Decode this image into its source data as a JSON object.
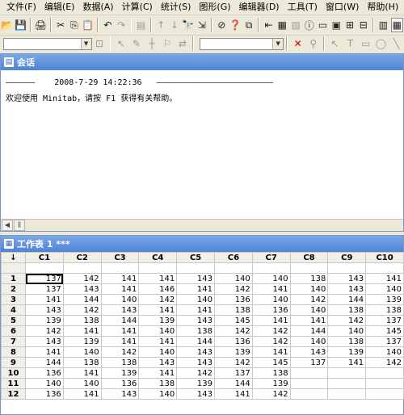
{
  "menu": [
    "文件(F)",
    "编辑(E)",
    "数据(A)",
    "计算(C)",
    "统计(S)",
    "图形(G)",
    "编辑器(D)",
    "工具(T)",
    "窗口(W)",
    "帮助(H)"
  ],
  "session": {
    "title": "会话",
    "header_line": "——————    2008-7-29 14:22:36   ————————————————————————",
    "welcome": "欢迎使用 Minitab，请按 F1 获得有关帮助。"
  },
  "worksheet": {
    "title": "工作表 1 ***",
    "corner": "↓",
    "columns": [
      "C1",
      "C2",
      "C3",
      "C4",
      "C5",
      "C6",
      "C7",
      "C8",
      "C9",
      "C10"
    ],
    "rows": [
      {
        "n": "1",
        "v": [
          "137",
          "142",
          "141",
          "141",
          "143",
          "140",
          "140",
          "138",
          "143",
          "141"
        ]
      },
      {
        "n": "2",
        "v": [
          "137",
          "143",
          "141",
          "146",
          "141",
          "142",
          "141",
          "140",
          "143",
          "140"
        ]
      },
      {
        "n": "3",
        "v": [
          "141",
          "144",
          "140",
          "142",
          "140",
          "136",
          "140",
          "142",
          "144",
          "139"
        ]
      },
      {
        "n": "4",
        "v": [
          "143",
          "142",
          "143",
          "141",
          "141",
          "138",
          "136",
          "140",
          "138",
          "138"
        ]
      },
      {
        "n": "5",
        "v": [
          "139",
          "138",
          "144",
          "139",
          "143",
          "145",
          "141",
          "141",
          "142",
          "137"
        ]
      },
      {
        "n": "6",
        "v": [
          "142",
          "141",
          "141",
          "140",
          "138",
          "142",
          "142",
          "144",
          "140",
          "145"
        ]
      },
      {
        "n": "7",
        "v": [
          "143",
          "139",
          "141",
          "141",
          "144",
          "136",
          "142",
          "140",
          "138",
          "137"
        ]
      },
      {
        "n": "8",
        "v": [
          "141",
          "140",
          "142",
          "140",
          "143",
          "139",
          "141",
          "143",
          "139",
          "140"
        ]
      },
      {
        "n": "9",
        "v": [
          "144",
          "138",
          "138",
          "143",
          "143",
          "142",
          "145",
          "137",
          "141",
          "142"
        ]
      },
      {
        "n": "10",
        "v": [
          "136",
          "141",
          "139",
          "141",
          "142",
          "137",
          "138",
          "",
          "",
          ""
        ]
      },
      {
        "n": "11",
        "v": [
          "140",
          "140",
          "136",
          "138",
          "139",
          "144",
          "139",
          "",
          "",
          ""
        ]
      },
      {
        "n": "12",
        "v": [
          "136",
          "141",
          "143",
          "140",
          "143",
          "141",
          "142",
          "",
          "",
          ""
        ]
      }
    ]
  }
}
